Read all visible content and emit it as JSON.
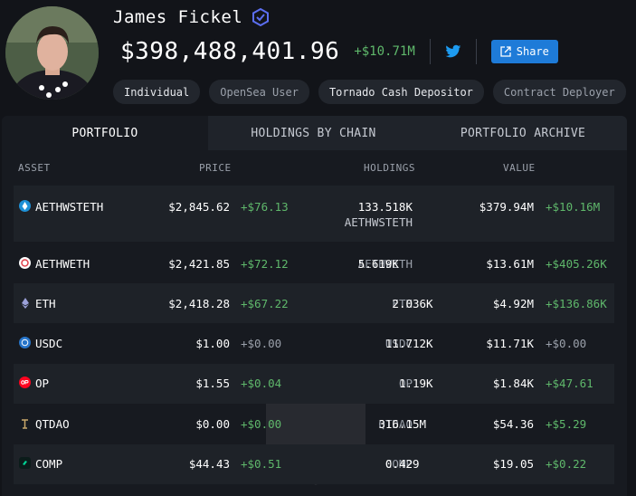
{
  "profile": {
    "name": "James Fickel",
    "total_value": "$398,488,401.96",
    "total_delta": "+$10.71M",
    "share_label": "Share"
  },
  "tags": [
    "Individual",
    "OpenSea User",
    "Tornado Cash Depositor",
    "Contract Deployer"
  ],
  "tabs": [
    "PORTFOLIO",
    "HOLDINGS BY CHAIN",
    "PORTFOLIO ARCHIVE"
  ],
  "columns": {
    "asset": "ASSET",
    "price": "PRICE",
    "holdings": "HOLDINGS",
    "value": "VALUE"
  },
  "rows": [
    {
      "asset": "AETHWSTETH",
      "price": "$2,845.62",
      "price_delta": "+$76.13",
      "holding_amount": "133.518K",
      "holding_unit": "AETHWSTETH",
      "value": "$379.94M",
      "value_delta": "+$10.16M",
      "icon": "wsteth-icon"
    },
    {
      "asset": "AETHWETH",
      "price": "$2,421.85",
      "price_delta": "+$72.12",
      "holding_amount": "5.619K",
      "holding_unit": "AETHWETH",
      "value": "$13.61M",
      "value_delta": "+$405.26K",
      "icon": "weth-icon"
    },
    {
      "asset": "ETH",
      "price": "$2,418.28",
      "price_delta": "+$67.22",
      "holding_amount": "2.036K",
      "holding_unit": "ETH",
      "value": "$4.92M",
      "value_delta": "+$136.86K",
      "icon": "eth-icon"
    },
    {
      "asset": "USDC",
      "price": "$1.00",
      "price_delta": "+$0.00",
      "holding_amount": "11.712K",
      "holding_unit": "USDC",
      "value": "$11.71K",
      "value_delta": "+$0.00",
      "icon": "usdc-icon"
    },
    {
      "asset": "OP",
      "price": "$1.55",
      "price_delta": "+$0.04",
      "holding_amount": "1.19K",
      "holding_unit": "OP",
      "value": "$1.84K",
      "value_delta": "+$47.61",
      "icon": "op-icon"
    },
    {
      "asset": "QTDAO",
      "price": "$0.00",
      "price_delta": "+$0.00",
      "holding_amount": "316.15M",
      "holding_unit": "QTDAO",
      "value": "$54.36",
      "value_delta": "+$5.29",
      "icon": "qtdao-icon"
    },
    {
      "asset": "COMP",
      "price": "$44.43",
      "price_delta": "+$0.51",
      "holding_amount": "0.429",
      "holding_unit": "COMP",
      "value": "$19.05",
      "value_delta": "+$0.22",
      "icon": "comp-icon"
    }
  ],
  "colors": {
    "positive": "#5fb86b",
    "neutral": "#9aa0aa",
    "accent": "#1e7bd8"
  }
}
